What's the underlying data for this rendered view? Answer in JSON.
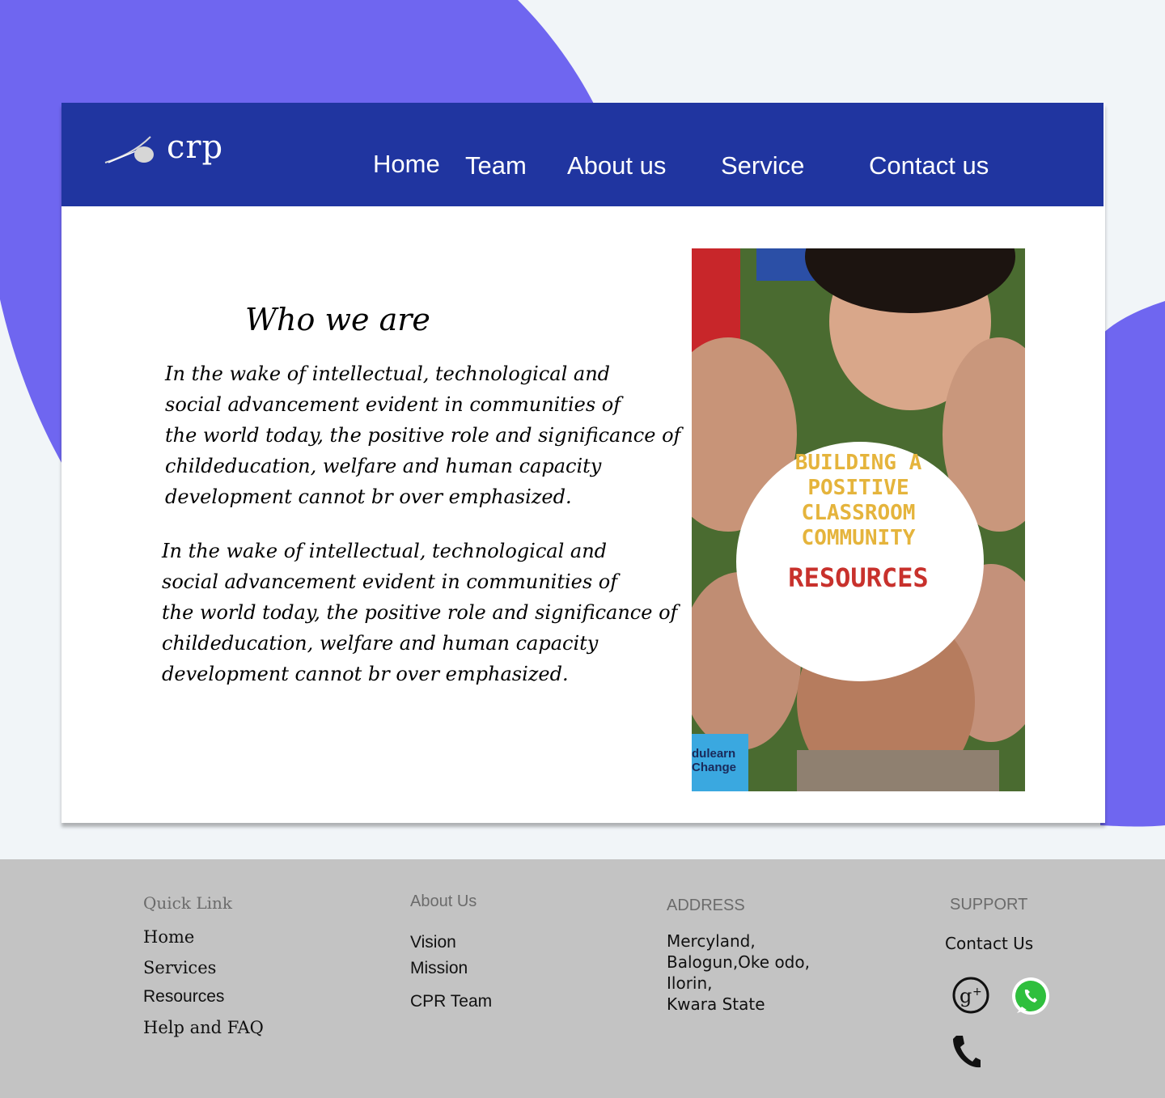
{
  "colors": {
    "accent_blob": "#6f66f0",
    "header": "#2035a0",
    "footer": "#c3c3c3",
    "page_bg": "#f1f5f8"
  },
  "brand": {
    "logo_text": "crp"
  },
  "nav": {
    "items": [
      {
        "label": "Home"
      },
      {
        "label": "Team"
      },
      {
        "label": "About us"
      },
      {
        "label": "Service"
      },
      {
        "label": "Contact us"
      }
    ]
  },
  "main": {
    "title": "Who we are",
    "paragraphs": [
      [
        "In the wake of intellectual, technological and",
        "social  advancement evident in communities of",
        "the world today, the positive role and significance of",
        "childeducation, welfare and human capacity",
        "development cannot br over emphasized."
      ],
      [
        "In the wake of intellectual, technological and",
        "social  advancement evident in communities of",
        "the world today, the positive role and significance of",
        "childeducation, welfare and human capacity",
        "development cannot br over emphasized."
      ]
    ],
    "image": {
      "lines": [
        "BUILDING A",
        "POSITIVE",
        "CLASSROOM",
        "COMMUNITY"
      ],
      "resources": "RESOURCES",
      "corner": [
        "dulearn",
        "Change"
      ]
    }
  },
  "footer": {
    "quick_link": {
      "heading": "Quick Link",
      "items": [
        "Home",
        "Services",
        "Resources",
        "Help and FAQ"
      ]
    },
    "about": {
      "heading": "About Us",
      "items": [
        "Vision",
        "Mission",
        "CPR Team"
      ]
    },
    "address": {
      "heading": "ADDRESS",
      "lines": [
        "Mercyland,",
        "Balogun,Oke odo,",
        "Ilorin,",
        "Kwara State"
      ]
    },
    "support": {
      "heading": "SUPPORT",
      "contact": "Contact Us",
      "icons": [
        "google-plus-icon",
        "whatsapp-icon",
        "phone-icon"
      ]
    }
  }
}
